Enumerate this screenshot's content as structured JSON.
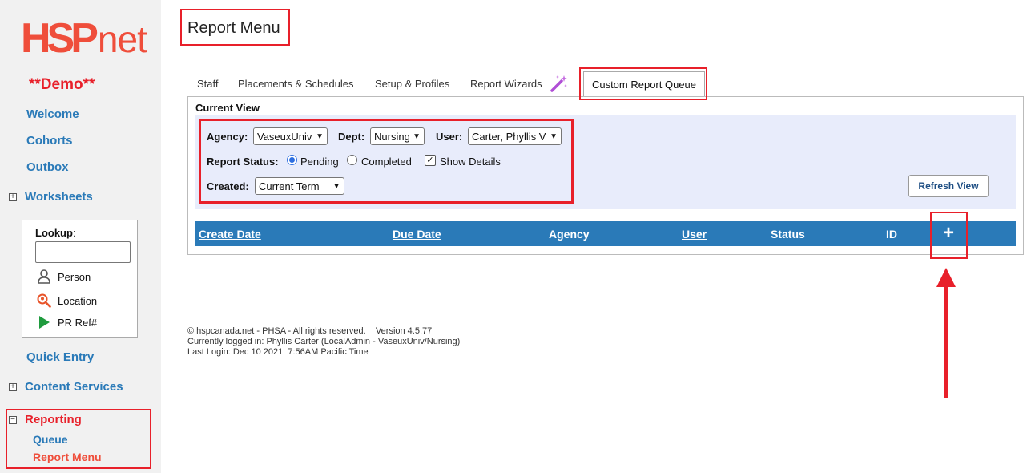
{
  "logo": {
    "part1": "HSP",
    "part2": "net"
  },
  "demo_label": "**Demo**",
  "sidebar": {
    "welcome": "Welcome",
    "cohorts": "Cohorts",
    "outbox": "Outbox",
    "worksheets": "Worksheets",
    "lookup": {
      "label": "Lookup",
      "colon": ":",
      "value": "",
      "person": "Person",
      "location": "Location",
      "pr_ref": "PR Ref#"
    },
    "quick_entry": "Quick Entry",
    "content_services": "Content Services",
    "reporting": "Reporting",
    "queue": "Queue",
    "report_menu": "Report Menu",
    "expand_glyph": "+",
    "collapse_glyph": "−"
  },
  "page_title": "Report Menu",
  "tabs": {
    "staff": "Staff",
    "placements": "Placements & Schedules",
    "setup": "Setup & Profiles",
    "wizards": "Report Wizards",
    "custom_queue": "Custom Report Queue"
  },
  "current_view": {
    "label": "Current View",
    "agency_label": "Agency:",
    "agency_value": "VaseuxUniv",
    "dept_label": "Dept:",
    "dept_value": "Nursing",
    "user_label": "User:",
    "user_value": "Carter, Phyllis V",
    "status_label": "Report Status:",
    "pending": "Pending",
    "completed": "Completed",
    "pending_selected": true,
    "show_details": "Show Details",
    "show_details_checked": true,
    "check_glyph": "✓",
    "created_label": "Created:",
    "created_value": "Current Term",
    "refresh": "Refresh View"
  },
  "table": {
    "create_date": "Create Date",
    "due_date": "Due Date",
    "agency": "Agency",
    "user": "User",
    "status": "Status",
    "id": "ID",
    "add": "+"
  },
  "footer": {
    "line1": "© hspcanada.net - PHSA - All rights reserved.    Version 4.5.77",
    "line2": "Currently logged in: Phyllis Carter (LocalAdmin - VaseuxUniv/Nursing)",
    "line3": "Last Login: Dec 10 2021  7:56AM Pacific Time"
  },
  "colors": {
    "brand": "#ef4e3b",
    "annotation": "#e8202a",
    "nav_link": "#2a7ab8",
    "header_bar": "#2a7ab8",
    "filter_bg": "#e8ecfb"
  }
}
